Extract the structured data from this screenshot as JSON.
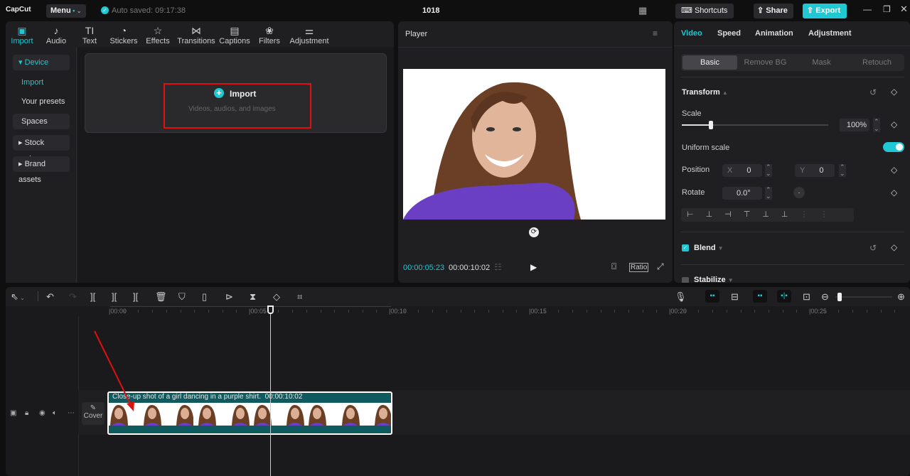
{
  "app": {
    "logo": "CapCut",
    "menu": "Menu",
    "autosave": "Auto saved: 09:17:38",
    "project_title": "1018",
    "shortcuts": "Shortcuts",
    "share": "Share",
    "export": "Export"
  },
  "media_tabs": [
    {
      "label": "Import",
      "icon": "import-icon"
    },
    {
      "label": "Audio",
      "icon": "audio-icon"
    },
    {
      "label": "Text",
      "icon": "text-icon"
    },
    {
      "label": "Stickers",
      "icon": "stickers-icon"
    },
    {
      "label": "Effects",
      "icon": "effects-icon"
    },
    {
      "label": "Transitions",
      "icon": "transitions-icon"
    },
    {
      "label": "Captions",
      "icon": "captions-icon"
    },
    {
      "label": "Filters",
      "icon": "filters-icon"
    },
    {
      "label": "Adjustment",
      "icon": "adjustment-icon"
    }
  ],
  "sidebar": {
    "device": "Device",
    "import": "Import",
    "presets": "Your presets",
    "spaces": "Spaces",
    "stock": "Stock mater...",
    "brand": "Brand assets"
  },
  "import_box": {
    "label": "Import",
    "hint": "Videos, audios, and images"
  },
  "player": {
    "title": "Player",
    "current_time": "00:00:05:23",
    "total_time": "00:00:10:02",
    "ratio": "Ratio"
  },
  "inspector": {
    "tabs": [
      "Video",
      "Speed",
      "Animation",
      "Adjustment"
    ],
    "subtabs": [
      "Basic",
      "Remove BG",
      "Mask",
      "Retouch"
    ],
    "transform": "Transform",
    "scale_label": "Scale",
    "scale_value": "100%",
    "scale_fraction": 0.2,
    "uniform_scale": "Uniform scale",
    "uniform_on": true,
    "position_label": "Position",
    "x_label": "X",
    "x_value": "0",
    "y_label": "Y",
    "y_value": "0",
    "rotate_label": "Rotate",
    "rotate_value": "0.0°",
    "blend": "Blend",
    "stabilize": "Stabilize"
  },
  "timeline": {
    "ticks": [
      "00:00",
      "00:05",
      "00:10",
      "00:15",
      "00:20",
      "00:25"
    ],
    "cover": "Cover",
    "clip_title": "Close-up shot of a girl dancing in a purple shirt.",
    "clip_duration": "00:00:10:02"
  },
  "colors": {
    "accent": "#1fc8d3",
    "clip": "#0e5a5e",
    "highlight": "#e01010"
  }
}
